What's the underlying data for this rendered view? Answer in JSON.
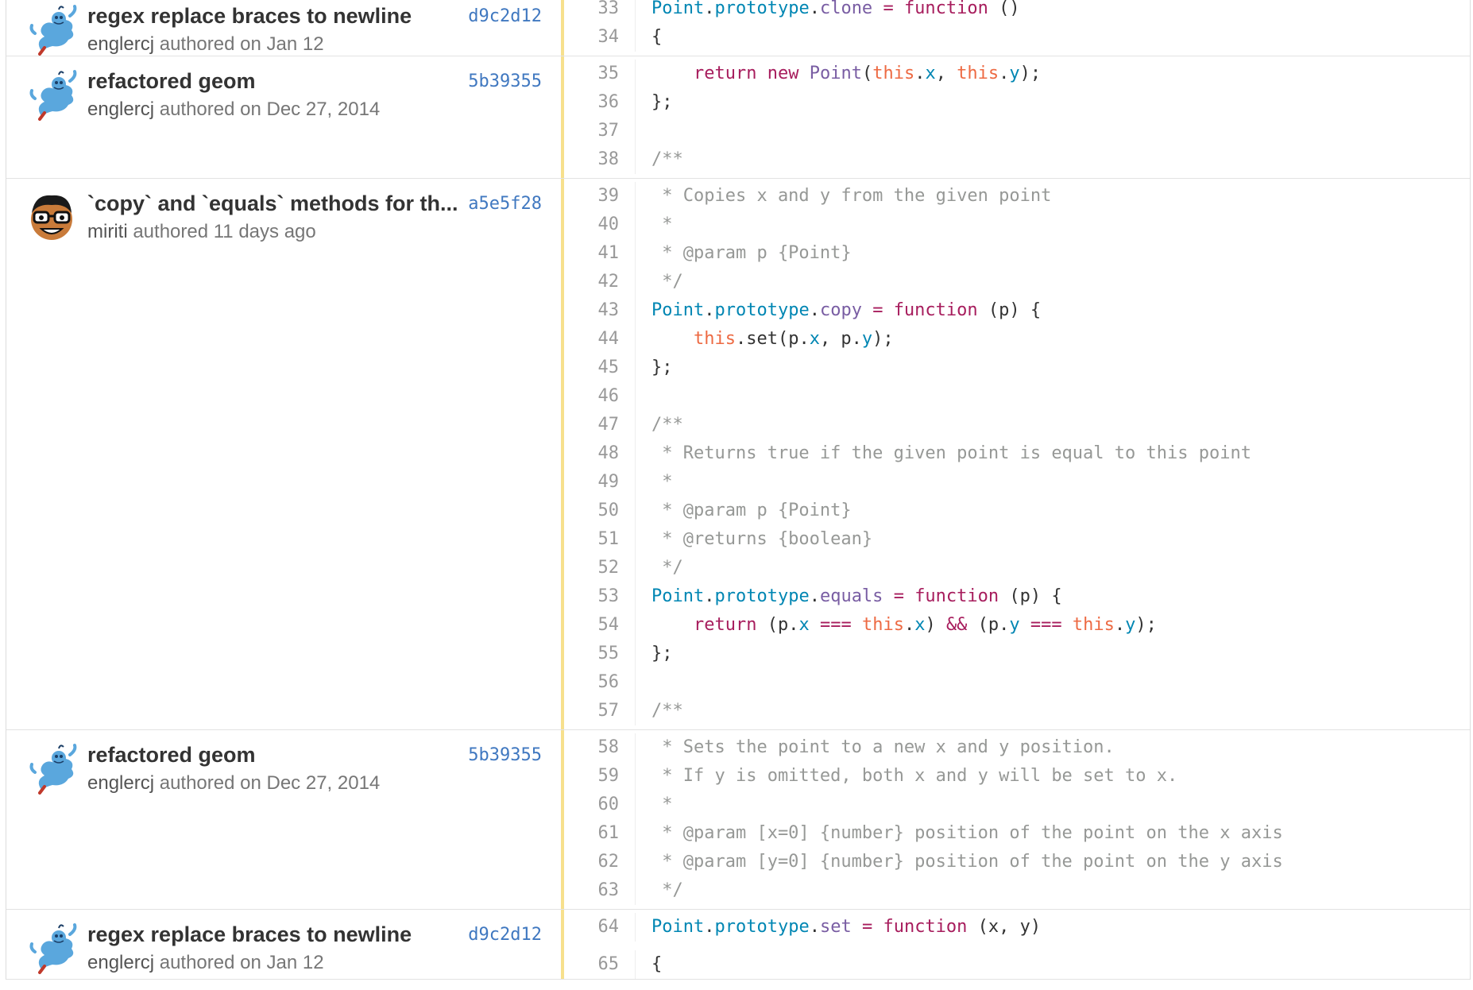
{
  "hunks": [
    {
      "message": "regex replace braces to newline",
      "sha": "d9c2d12",
      "author": "englercj",
      "authored": "authored on Jan 12",
      "avatar": "genie-avatar-icon",
      "lines": [
        {
          "no": "33",
          "tokens": [
            [
              "ident",
              "Point"
            ],
            [
              "pl",
              "."
            ],
            [
              "ident",
              "prototype"
            ],
            [
              "pl",
              "."
            ],
            [
              "prop",
              "clone"
            ],
            [
              "pl",
              " "
            ],
            [
              "kw",
              "="
            ],
            [
              "pl",
              " "
            ],
            [
              "kw",
              "function"
            ],
            [
              "pl",
              " ()"
            ]
          ]
        },
        {
          "no": "34",
          "tokens": [
            [
              "pl",
              "{"
            ]
          ]
        }
      ]
    },
    {
      "message": "refactored geom",
      "sha": "5b39355",
      "author": "englercj",
      "authored": "authored on Dec 27, 2014",
      "avatar": "genie-avatar-icon",
      "lines": [
        {
          "no": "35",
          "tokens": [
            [
              "pl",
              "    "
            ],
            [
              "kw",
              "return"
            ],
            [
              "pl",
              " "
            ],
            [
              "kw",
              "new"
            ],
            [
              "pl",
              " "
            ],
            [
              "prop",
              "Point"
            ],
            [
              "pl",
              "("
            ],
            [
              "this",
              "this"
            ],
            [
              "pl",
              "."
            ],
            [
              "field",
              "x"
            ],
            [
              "pl",
              ", "
            ],
            [
              "this",
              "this"
            ],
            [
              "pl",
              "."
            ],
            [
              "field",
              "y"
            ],
            [
              "pl",
              ");"
            ]
          ]
        },
        {
          "no": "36",
          "tokens": [
            [
              "pl",
              "};"
            ]
          ]
        },
        {
          "no": "37",
          "tokens": []
        },
        {
          "no": "38",
          "tokens": [
            [
              "cm",
              "/**"
            ]
          ]
        }
      ]
    },
    {
      "message": "`copy` and `equals` methods for th...",
      "sha": "a5e5f28",
      "author": "miriti",
      "authored": "authored 11 days ago",
      "avatar": "glasses-face-avatar-icon",
      "lines": [
        {
          "no": "39",
          "tokens": [
            [
              "cm",
              " * Copies x and y from the given point"
            ]
          ]
        },
        {
          "no": "40",
          "tokens": [
            [
              "cm",
              " *"
            ]
          ]
        },
        {
          "no": "41",
          "tokens": [
            [
              "cm",
              " * @param p {Point}"
            ]
          ]
        },
        {
          "no": "42",
          "tokens": [
            [
              "cm",
              " */"
            ]
          ]
        },
        {
          "no": "43",
          "tokens": [
            [
              "ident",
              "Point"
            ],
            [
              "pl",
              "."
            ],
            [
              "ident",
              "prototype"
            ],
            [
              "pl",
              "."
            ],
            [
              "prop",
              "copy"
            ],
            [
              "pl",
              " "
            ],
            [
              "kw",
              "="
            ],
            [
              "pl",
              " "
            ],
            [
              "kw",
              "function"
            ],
            [
              "pl",
              " (p) {"
            ]
          ]
        },
        {
          "no": "44",
          "tokens": [
            [
              "pl",
              "    "
            ],
            [
              "this",
              "this"
            ],
            [
              "pl",
              ".set(p."
            ],
            [
              "field",
              "x"
            ],
            [
              "pl",
              ", p."
            ],
            [
              "field",
              "y"
            ],
            [
              "pl",
              ");"
            ]
          ]
        },
        {
          "no": "45",
          "tokens": [
            [
              "pl",
              "};"
            ]
          ]
        },
        {
          "no": "46",
          "tokens": []
        },
        {
          "no": "47",
          "tokens": [
            [
              "cm",
              "/**"
            ]
          ]
        },
        {
          "no": "48",
          "tokens": [
            [
              "cm",
              " * Returns true if the given point is equal to this point"
            ]
          ]
        },
        {
          "no": "49",
          "tokens": [
            [
              "cm",
              " *"
            ]
          ]
        },
        {
          "no": "50",
          "tokens": [
            [
              "cm",
              " * @param p {Point}"
            ]
          ]
        },
        {
          "no": "51",
          "tokens": [
            [
              "cm",
              " * @returns {boolean}"
            ]
          ]
        },
        {
          "no": "52",
          "tokens": [
            [
              "cm",
              " */"
            ]
          ]
        },
        {
          "no": "53",
          "tokens": [
            [
              "ident",
              "Point"
            ],
            [
              "pl",
              "."
            ],
            [
              "ident",
              "prototype"
            ],
            [
              "pl",
              "."
            ],
            [
              "prop",
              "equals"
            ],
            [
              "pl",
              " "
            ],
            [
              "kw",
              "="
            ],
            [
              "pl",
              " "
            ],
            [
              "kw",
              "function"
            ],
            [
              "pl",
              " (p) {"
            ]
          ]
        },
        {
          "no": "54",
          "tokens": [
            [
              "pl",
              "    "
            ],
            [
              "kw",
              "return"
            ],
            [
              "pl",
              " (p."
            ],
            [
              "field",
              "x"
            ],
            [
              "pl",
              " "
            ],
            [
              "kw",
              "==="
            ],
            [
              "pl",
              " "
            ],
            [
              "this",
              "this"
            ],
            [
              "pl",
              "."
            ],
            [
              "field",
              "x"
            ],
            [
              "pl",
              ") "
            ],
            [
              "kw",
              "&&"
            ],
            [
              "pl",
              " (p."
            ],
            [
              "field",
              "y"
            ],
            [
              "pl",
              " "
            ],
            [
              "kw",
              "==="
            ],
            [
              "pl",
              " "
            ],
            [
              "this",
              "this"
            ],
            [
              "pl",
              "."
            ],
            [
              "field",
              "y"
            ],
            [
              "pl",
              ");"
            ]
          ]
        },
        {
          "no": "55",
          "tokens": [
            [
              "pl",
              "};"
            ]
          ]
        },
        {
          "no": "56",
          "tokens": []
        },
        {
          "no": "57",
          "tokens": [
            [
              "cm",
              "/**"
            ]
          ]
        }
      ]
    },
    {
      "message": "refactored geom",
      "sha": "5b39355",
      "author": "englercj",
      "authored": "authored on Dec 27, 2014",
      "avatar": "genie-avatar-icon",
      "lines": [
        {
          "no": "58",
          "tokens": [
            [
              "cm",
              " * Sets the point to a new x and y position."
            ]
          ]
        },
        {
          "no": "59",
          "tokens": [
            [
              "cm",
              " * If y is omitted, both x and y will be set to x."
            ]
          ]
        },
        {
          "no": "60",
          "tokens": [
            [
              "cm",
              " *"
            ]
          ]
        },
        {
          "no": "61",
          "tokens": [
            [
              "cm",
              " * @param [x=0] {number} position of the point on the x axis"
            ]
          ]
        },
        {
          "no": "62",
          "tokens": [
            [
              "cm",
              " * @param [y=0] {number} position of the point on the y axis"
            ]
          ]
        },
        {
          "no": "63",
          "tokens": [
            [
              "cm",
              " */"
            ]
          ]
        }
      ]
    },
    {
      "message": "regex replace braces to newline",
      "sha": "d9c2d12",
      "author": "englercj",
      "authored": "authored on Jan 12",
      "avatar": "genie-avatar-icon",
      "lines": [
        {
          "no": "64",
          "tokens": [
            [
              "ident",
              "Point"
            ],
            [
              "pl",
              "."
            ],
            [
              "ident",
              "prototype"
            ],
            [
              "pl",
              "."
            ],
            [
              "prop",
              "set"
            ],
            [
              "pl",
              " "
            ],
            [
              "kw",
              "="
            ],
            [
              "pl",
              " "
            ],
            [
              "kw",
              "function"
            ],
            [
              "pl",
              " (x, y)"
            ]
          ]
        },
        {
          "no": "65",
          "tokens": [
            [
              "pl",
              "{"
            ]
          ]
        }
      ]
    }
  ]
}
